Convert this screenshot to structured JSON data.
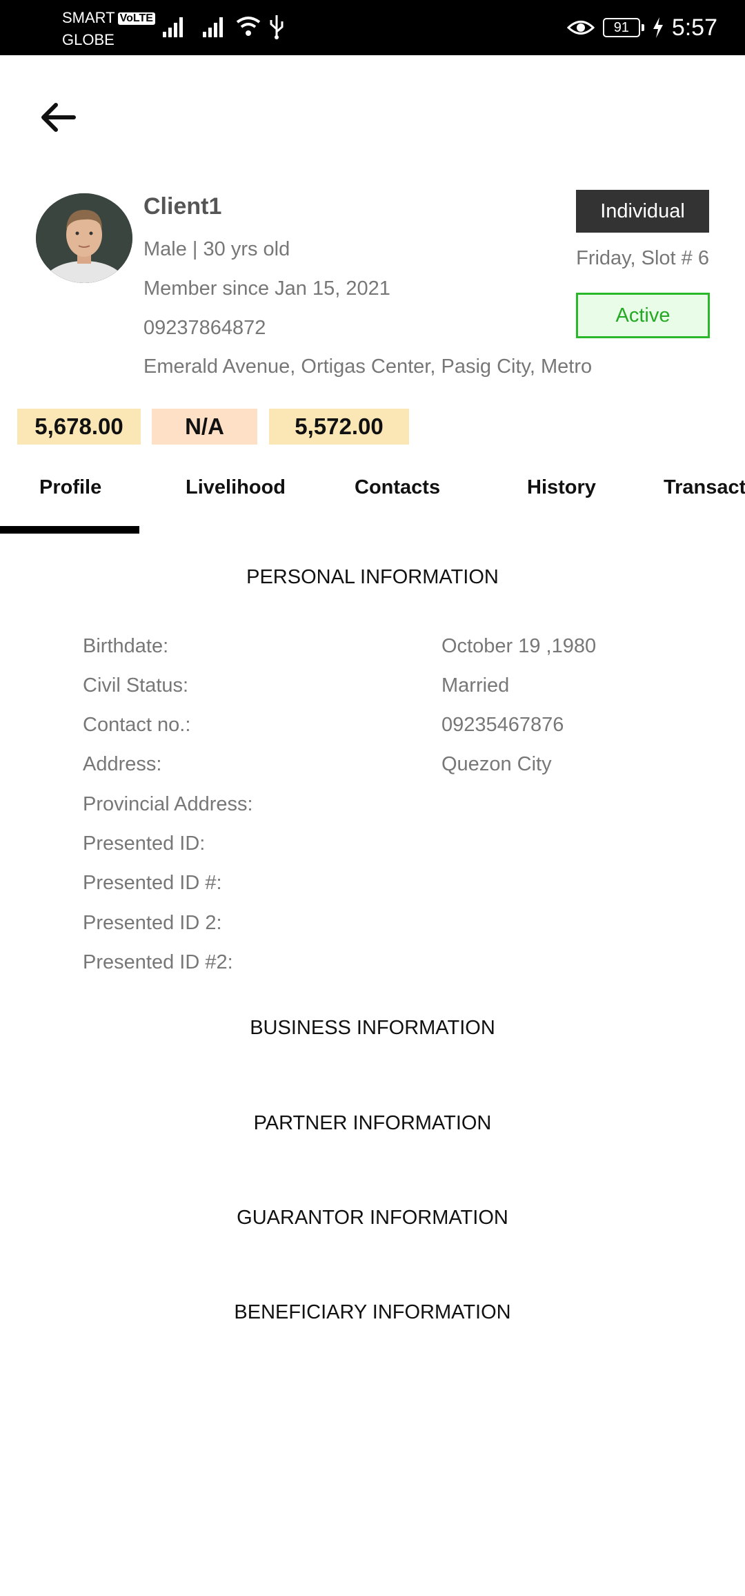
{
  "status_bar": {
    "carrier1": "SMART",
    "volte": "VoLTE",
    "carrier2": "GLOBE",
    "battery": "91",
    "time": "5:57"
  },
  "client": {
    "name": "Client1",
    "gender_age": "Male | 30 yrs old",
    "member_since": "Member since Jan 15, 2021",
    "phone": "09237864872",
    "address": "Emerald Avenue, Ortigas Center, Pasig City, Metro Manila",
    "type": "Individual",
    "slot": "Friday, Slot # 6",
    "status": "Active"
  },
  "amounts": [
    "5,678.00",
    "N/A",
    "5,572.00"
  ],
  "tabs": [
    "Profile",
    "Livelihood",
    "Contacts",
    "History",
    "Transactions"
  ],
  "personal_information": {
    "title": "PERSONAL INFORMATION",
    "fields": [
      {
        "label": "Birthdate:",
        "value": "October 19 ,1980"
      },
      {
        "label": "Civil Status:",
        "value": "Married"
      },
      {
        "label": "Contact no.:",
        "value": "09235467876"
      },
      {
        "label": "Address:",
        "value": "Quezon City"
      },
      {
        "label": "Provincial Address:",
        "value": ""
      },
      {
        "label": "Presented ID:",
        "value": ""
      },
      {
        "label": "Presented ID #:",
        "value": ""
      },
      {
        "label": "Presented ID 2:",
        "value": ""
      },
      {
        "label": "Presented ID #2:",
        "value": ""
      }
    ]
  },
  "sections": {
    "business": "BUSINESS INFORMATION",
    "partner": "PARTNER INFORMATION",
    "guarantor": "GUARANTOR INFORMATION",
    "beneficiary": "BENEFICIARY INFORMATION"
  },
  "colors": {
    "active_green": "#25a925",
    "amount_bg": "#fbe7b5",
    "na_bg": "#fde0c5",
    "badge_dark": "#333333"
  }
}
